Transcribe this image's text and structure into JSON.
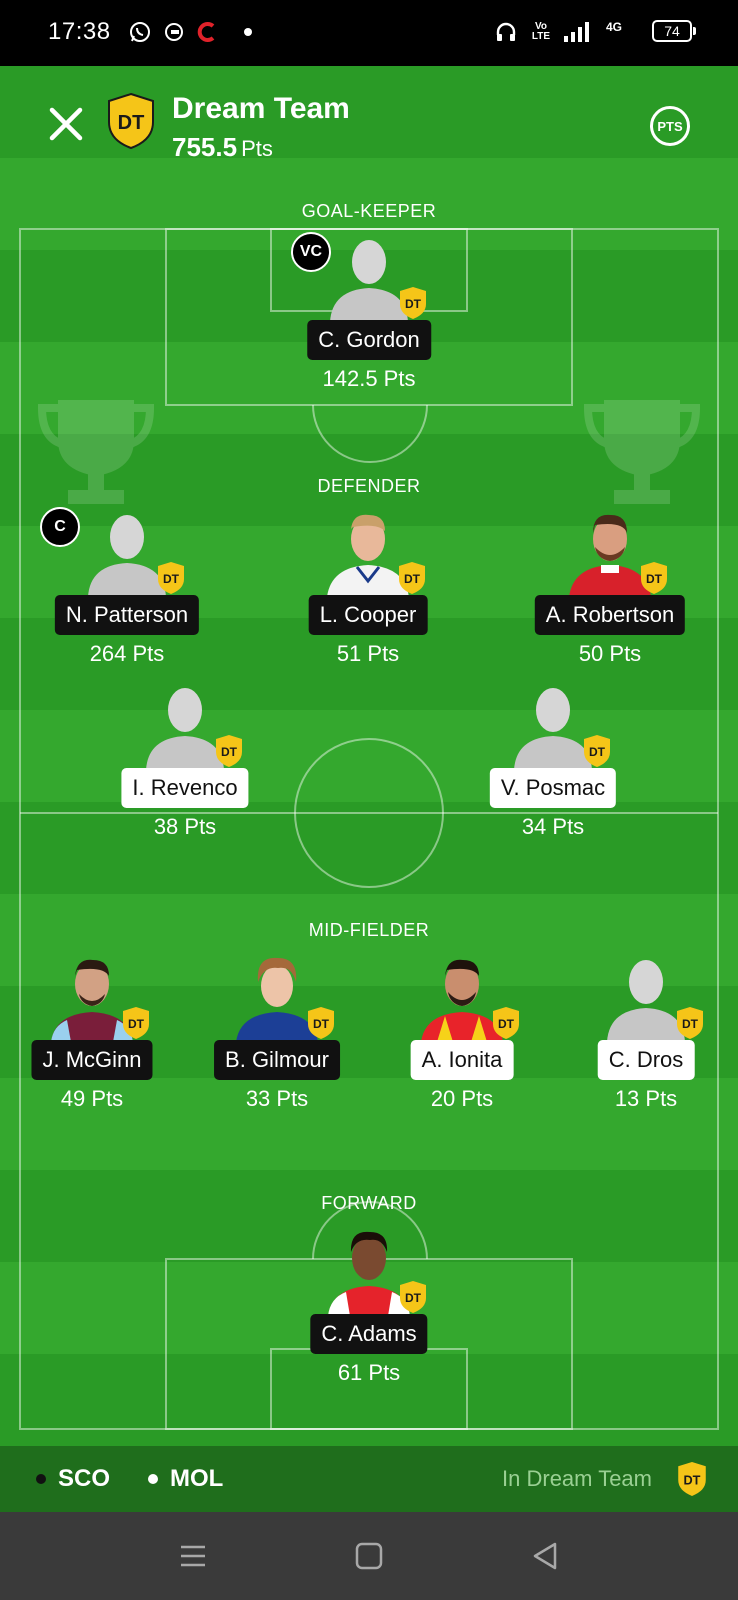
{
  "status_bar": {
    "time": "17:38",
    "network_label": "4G",
    "volte_label": "Vo LTE",
    "battery": "74"
  },
  "header": {
    "badge": "DT",
    "title": "Dream Team",
    "points": "755.5",
    "points_unit": "Pts",
    "pts_button": "PTS"
  },
  "sections": {
    "goalkeeper": "GOAL-KEEPER",
    "defender": "DEFENDER",
    "midfielder": "MID-FIELDER",
    "forward": "FORWARD"
  },
  "players": {
    "gk1": {
      "name": "C. Gordon",
      "points": "142.5 Pts",
      "role": "VC",
      "badge": "DT"
    },
    "def1": {
      "name": "N. Patterson",
      "points": "264 Pts",
      "role": "C",
      "badge": "DT"
    },
    "def2": {
      "name": "L. Cooper",
      "points": "51 Pts",
      "badge": "DT"
    },
    "def3": {
      "name": "A. Robertson",
      "points": "50 Pts",
      "badge": "DT"
    },
    "def4": {
      "name": "I. Revenco",
      "points": "38 Pts",
      "badge": "DT"
    },
    "def5": {
      "name": "V. Posmac",
      "points": "34 Pts",
      "badge": "DT"
    },
    "mid1": {
      "name": "J. McGinn",
      "points": "49 Pts",
      "badge": "DT"
    },
    "mid2": {
      "name": "B. Gilmour",
      "points": "33 Pts",
      "badge": "DT"
    },
    "mid3": {
      "name": "A. Ionita",
      "points": "20 Pts",
      "badge": "DT"
    },
    "mid4": {
      "name": "C. Dros",
      "points": "13 Pts",
      "badge": "DT"
    },
    "fwd1": {
      "name": "C. Adams",
      "points": "61 Pts",
      "badge": "DT"
    }
  },
  "legend": {
    "team_a": "SCO",
    "team_b": "MOL",
    "in_dream_team": "In Dream Team",
    "badge": "DT"
  },
  "colors": {
    "team_a": "#111111",
    "team_b": "#ffffff",
    "dt_badge": "#f5c518",
    "pitch": "#2e9e29"
  }
}
